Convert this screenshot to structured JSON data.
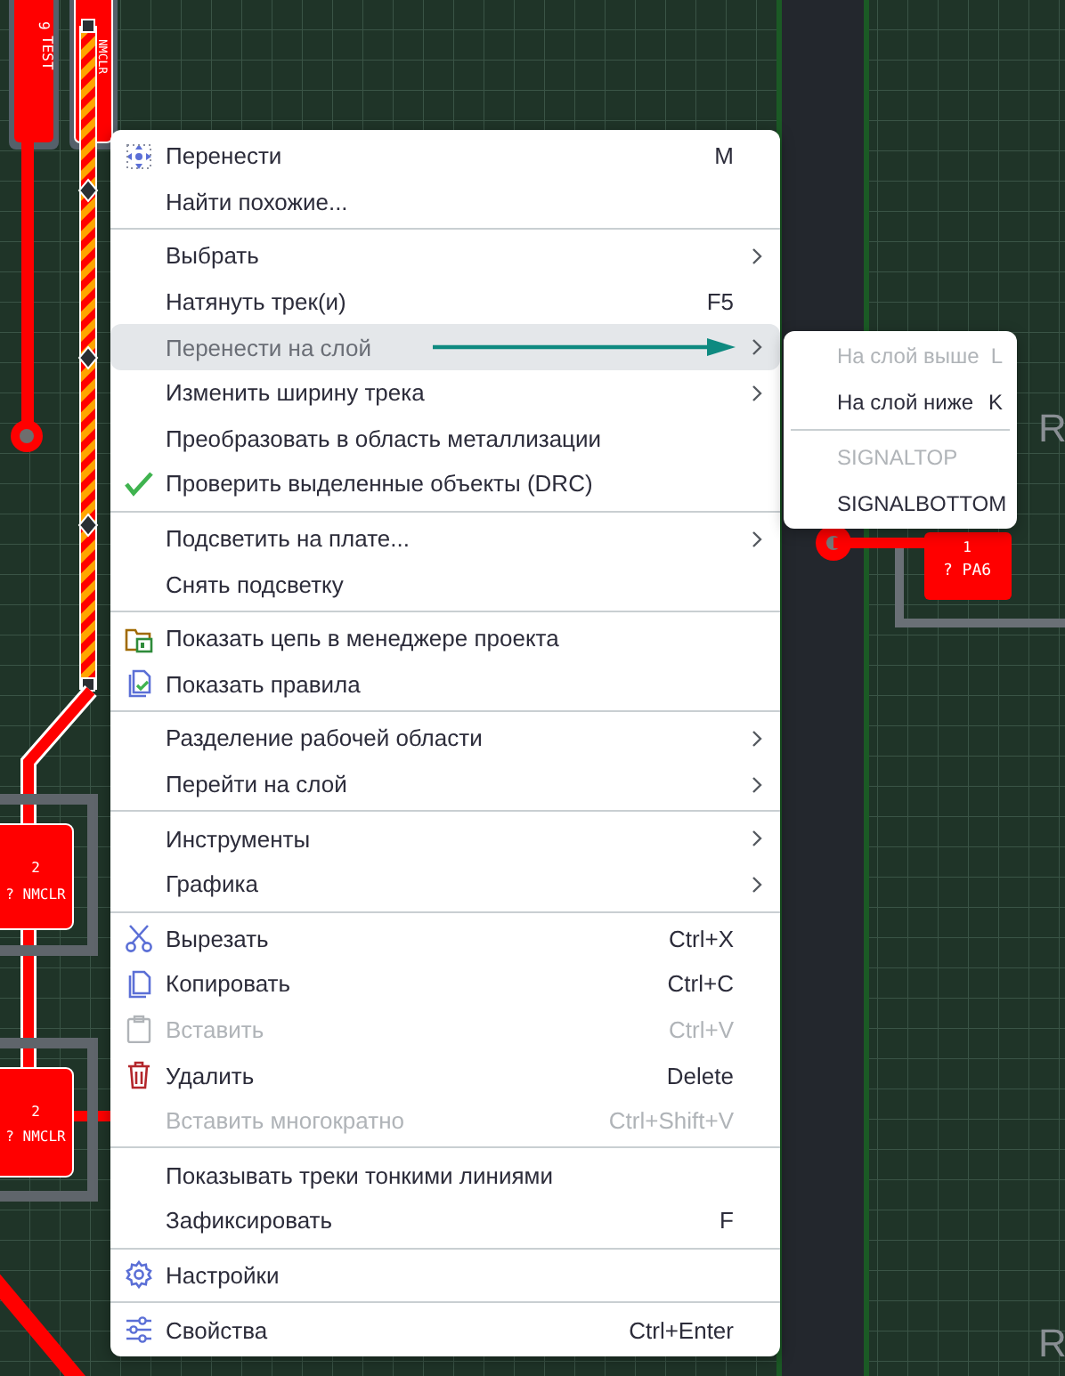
{
  "board": {
    "pads": [
      {
        "number": "9",
        "name": "TEST"
      },
      {
        "name": "NMCLR"
      },
      {
        "number": "2",
        "name": "? NMCLR"
      },
      {
        "number": "2",
        "name": "? NMCLR"
      },
      {
        "number": "1",
        "name": "? PA6"
      }
    ],
    "designators": [
      "R",
      "R"
    ]
  },
  "menu": {
    "groups": [
      [
        {
          "label": "Перенести",
          "shortcut": "M",
          "has_submenu": false,
          "disabled": false,
          "selected": false
        },
        {
          "label": "Найти похожие...",
          "has_submenu": false,
          "disabled": false,
          "selected": false
        }
      ],
      [
        {
          "label": "Выбрать",
          "has_submenu": true,
          "disabled": false,
          "selected": false
        },
        {
          "label": "Натянуть трек(и)",
          "shortcut": "F5",
          "has_submenu": false,
          "disabled": false,
          "selected": false
        },
        {
          "label": "Перенести на слой",
          "has_submenu": true,
          "disabled": false,
          "selected": true
        },
        {
          "label": "Изменить ширину трека",
          "has_submenu": true,
          "disabled": false,
          "selected": false
        },
        {
          "label": "Преобразовать в область металлизации",
          "has_submenu": false,
          "disabled": false,
          "selected": false
        },
        {
          "label": "Проверить выделенные объекты (DRC)",
          "has_submenu": false,
          "disabled": false,
          "selected": false
        }
      ],
      [
        {
          "label": "Подсветить на плате...",
          "has_submenu": true,
          "disabled": false,
          "selected": false
        },
        {
          "label": "Снять подсветку",
          "has_submenu": false,
          "disabled": false,
          "selected": false
        }
      ],
      [
        {
          "label": "Показать цепь в менеджере проекта",
          "has_submenu": false,
          "disabled": false,
          "selected": false
        },
        {
          "label": "Показать правила",
          "has_submenu": false,
          "disabled": false,
          "selected": false
        }
      ],
      [
        {
          "label": "Разделение рабочей области",
          "has_submenu": true,
          "disabled": false,
          "selected": false
        },
        {
          "label": "Перейти на слой",
          "has_submenu": true,
          "disabled": false,
          "selected": false
        }
      ],
      [
        {
          "label": "Инструменты",
          "has_submenu": true,
          "disabled": false,
          "selected": false
        },
        {
          "label": "Графика",
          "has_submenu": true,
          "disabled": false,
          "selected": false
        }
      ],
      [
        {
          "label": "Вырезать",
          "shortcut": "Ctrl+X",
          "has_submenu": false,
          "disabled": false,
          "selected": false
        },
        {
          "label": "Копировать",
          "shortcut": "Ctrl+C",
          "has_submenu": false,
          "disabled": false,
          "selected": false
        },
        {
          "label": "Вставить",
          "shortcut": "Ctrl+V",
          "has_submenu": false,
          "disabled": true,
          "selected": false
        },
        {
          "label": "Удалить",
          "shortcut": "Delete",
          "has_submenu": false,
          "disabled": false,
          "selected": false
        },
        {
          "label": "Вставить многократно",
          "shortcut": "Ctrl+Shift+V",
          "has_submenu": false,
          "disabled": true,
          "selected": false
        }
      ],
      [
        {
          "label": "Показывать треки тонкими линиями",
          "has_submenu": false,
          "disabled": false,
          "selected": false
        },
        {
          "label": "Зафиксировать",
          "shortcut": "F",
          "has_submenu": false,
          "disabled": false,
          "selected": false
        }
      ],
      [
        {
          "label": "Настройки",
          "has_submenu": false,
          "disabled": false,
          "selected": false
        }
      ],
      [
        {
          "label": "Свойства",
          "shortcut": "Ctrl+Enter",
          "has_submenu": false,
          "disabled": false,
          "selected": false
        }
      ]
    ]
  },
  "submenu": {
    "groups": [
      [
        {
          "label": "На слой выше",
          "shortcut": "L",
          "disabled": true
        },
        {
          "label": "На слой ниже",
          "shortcut": "K",
          "disabled": false
        }
      ],
      [
        {
          "label": "SIGNALTOP",
          "disabled": true
        },
        {
          "label": "SIGNALBOTTOM",
          "disabled": false
        }
      ]
    ]
  }
}
